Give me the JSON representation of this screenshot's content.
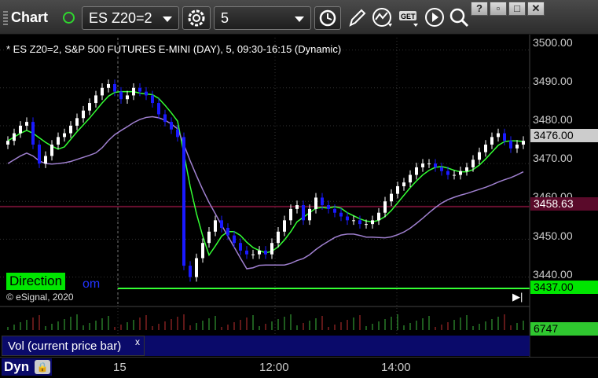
{
  "toolbar": {
    "app_title": "Chart",
    "symbol": "ES Z20=2",
    "interval": "5",
    "icons": [
      "settings-icon",
      "clock-icon",
      "pencil-icon",
      "indicator-icon",
      "get-icon",
      "play-icon",
      "search-icon"
    ],
    "window_buttons": [
      "?",
      "□",
      "□",
      "✕"
    ]
  },
  "chart": {
    "title": "* ES Z20=2, S&P 500 FUTURES E-MINI (DAY), 5, 09:30-16:15 (Dynamic)",
    "direction_label": "Direction",
    "direction_suffix": "om",
    "copyright": "© eSignal, 2020",
    "price_ticks": [
      "3500.00",
      "3490.00",
      "3480.00",
      "3470.00",
      "3460.00",
      "3450.00",
      "3440.00"
    ],
    "last_price": "3476.00",
    "level_price": "3458.63",
    "low_level": "3437.00",
    "colors": {
      "up": "#ffffff",
      "down": "#1a1aff",
      "green_line": "#33ff33",
      "red_line": "#ff2020",
      "purple_line": "#a080d0",
      "background": "#000000"
    }
  },
  "chart_data": {
    "type": "candlestick",
    "ylim": [
      3437,
      3502
    ],
    "series": [
      {
        "name": "price",
        "values": [
          3476,
          3478,
          3480,
          3481,
          3475,
          3470,
          3472,
          3475,
          3477,
          3478,
          3480,
          3482,
          3484,
          3486,
          3488,
          3490,
          3491,
          3489,
          3487,
          3488,
          3490,
          3489,
          3488,
          3486,
          3483,
          3481,
          3479,
          3477,
          3443,
          3440,
          3445,
          3449,
          3452,
          3455,
          3453,
          3451,
          3449,
          3447,
          3446,
          3446,
          3447,
          3446,
          3449,
          3452,
          3455,
          3458,
          3459,
          3455,
          3458,
          3461,
          3459,
          3458,
          3457,
          3456,
          3455,
          3455,
          3454,
          3454,
          3455,
          3457,
          3460,
          3462,
          3464,
          3465,
          3467,
          3469,
          3470,
          3470,
          3469,
          3468,
          3467,
          3467,
          3468,
          3469,
          3471,
          3473,
          3475,
          3477,
          3478,
          3476,
          3474,
          3475,
          3476
        ]
      }
    ]
  },
  "volume": {
    "label": "Vol (current price bar)",
    "close": "x",
    "current": "6747"
  },
  "time_axis": {
    "label": "Dyn",
    "lock_icon": "lock-icon",
    "ticks": [
      "15",
      "12:00",
      "14:00"
    ]
  }
}
